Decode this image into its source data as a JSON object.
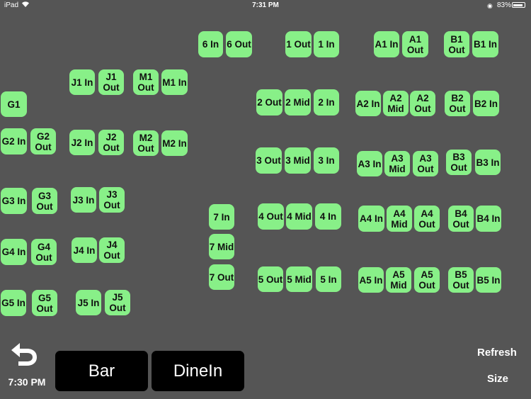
{
  "status_bar": {
    "device": "iPad",
    "time": "7:31 PM",
    "battery": "83%",
    "icons": [
      "wifi-icon",
      "orientation-lock-icon",
      "battery-icon"
    ]
  },
  "tables": [
    {
      "label": "6 In"
    },
    {
      "label": "6 Out"
    },
    {
      "label": "1 Out"
    },
    {
      "label": "1 In"
    },
    {
      "label": "A1 In"
    },
    {
      "label": "A1\nOut"
    },
    {
      "label": "B1\nOut"
    },
    {
      "label": "B1 In"
    },
    {
      "label": "J1 In"
    },
    {
      "label": "J1\nOut"
    },
    {
      "label": "M1\nOut"
    },
    {
      "label": "M1 In"
    },
    {
      "label": "G1"
    },
    {
      "label": "2 Out"
    },
    {
      "label": "2 Mid"
    },
    {
      "label": "2 In"
    },
    {
      "label": "A2 In"
    },
    {
      "label": "A2\nMid"
    },
    {
      "label": "A2\nOut"
    },
    {
      "label": "B2\nOut"
    },
    {
      "label": "B2 In"
    },
    {
      "label": "G2 In"
    },
    {
      "label": "G2\nOut"
    },
    {
      "label": "J2 In"
    },
    {
      "label": "J2\nOut"
    },
    {
      "label": "M2\nOut"
    },
    {
      "label": "M2 In"
    },
    {
      "label": "3 Out"
    },
    {
      "label": "3 Mid"
    },
    {
      "label": "3 In"
    },
    {
      "label": "A3 In"
    },
    {
      "label": "A3\nMid"
    },
    {
      "label": "A3\nOut"
    },
    {
      "label": "B3\nOut"
    },
    {
      "label": "B3 In"
    },
    {
      "label": "G3 In"
    },
    {
      "label": "G3\nOut"
    },
    {
      "label": "J3 In"
    },
    {
      "label": "J3\nOut"
    },
    {
      "label": "7 In"
    },
    {
      "label": "4 Out"
    },
    {
      "label": "4 Mid"
    },
    {
      "label": "4 In"
    },
    {
      "label": "A4 In"
    },
    {
      "label": "A4\nMid"
    },
    {
      "label": "A4\nOut"
    },
    {
      "label": "B4\nOut"
    },
    {
      "label": "B4 In"
    },
    {
      "label": "7 Mid"
    },
    {
      "label": "G4 In"
    },
    {
      "label": "G4\nOut"
    },
    {
      "label": "J4 In"
    },
    {
      "label": "J4\nOut"
    },
    {
      "label": "7 Out"
    },
    {
      "label": "5 Out"
    },
    {
      "label": "5 Mid"
    },
    {
      "label": "5 In"
    },
    {
      "label": "A5 In"
    },
    {
      "label": "A5\nMid"
    },
    {
      "label": "A5\nOut"
    },
    {
      "label": "B5\nOut"
    },
    {
      "label": "B5 In"
    },
    {
      "label": "G5 In"
    },
    {
      "label": "G5\nOut"
    },
    {
      "label": "J5 In"
    },
    {
      "label": "J5\nOut"
    }
  ],
  "footer": {
    "back_icon": "back-arrow-icon",
    "time": "7:30 PM",
    "tabs": [
      {
        "label": "Bar"
      },
      {
        "label": "DineIn"
      }
    ],
    "refresh_label": "Refresh",
    "size_label": "Size"
  },
  "colors": {
    "background": "#555555",
    "table_fill": "#88f088",
    "tab_fill": "#000000"
  }
}
